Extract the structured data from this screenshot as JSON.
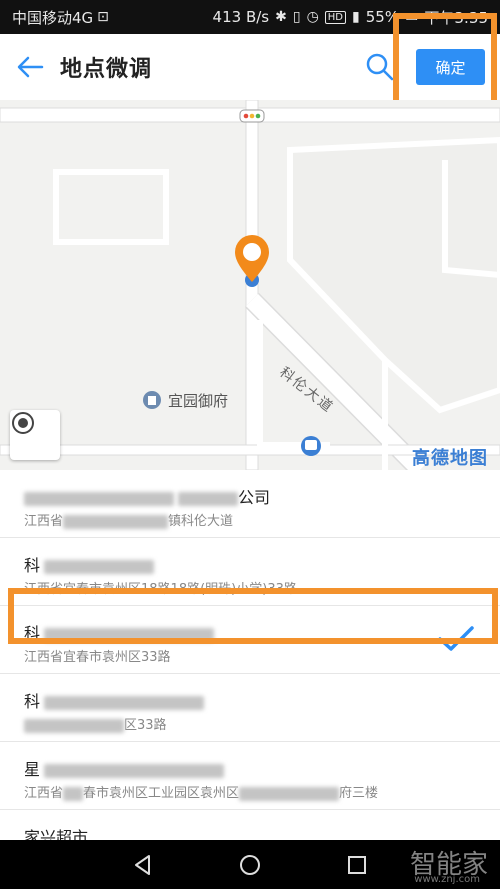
{
  "status_bar": {
    "carrier": "中国移动4G",
    "speed": "413 B/s",
    "battery": "55%",
    "time": "下午3:35",
    "hd": "HD",
    "signal": "4G"
  },
  "header": {
    "title": "地点微调",
    "confirm_label": "确定"
  },
  "map": {
    "poi_name": "宜园御府",
    "road_name": "科伦大道",
    "brand": "高德地图"
  },
  "list": {
    "items": [
      {
        "name_suffix": "公司",
        "addr_prefix": "江西省",
        "addr_suffix": "镇科伦大道"
      },
      {
        "name_prefix": "科",
        "addr_prefix": "江西省宜春市袁州区",
        "addr_suffix": "18路18路(明珠)小学)33路"
      },
      {
        "name_prefix": "科",
        "addr_prefix": "江西省宜春市袁州区33路",
        "selected": true
      },
      {
        "name_prefix": "科",
        "addr_suffix": "区33路"
      },
      {
        "name_prefix": "星",
        "addr_prefix": "江西省",
        "addr_mid": "春市袁州区工业园区袁州区",
        "addr_suffix": "府三楼"
      },
      {
        "name": "家兴超市"
      }
    ]
  },
  "watermark": {
    "text": "智能家",
    "url": "www.znj.com"
  },
  "colors": {
    "accent": "#2e8ff5",
    "highlight": "#f3922d",
    "brand": "#3b7fd4"
  }
}
